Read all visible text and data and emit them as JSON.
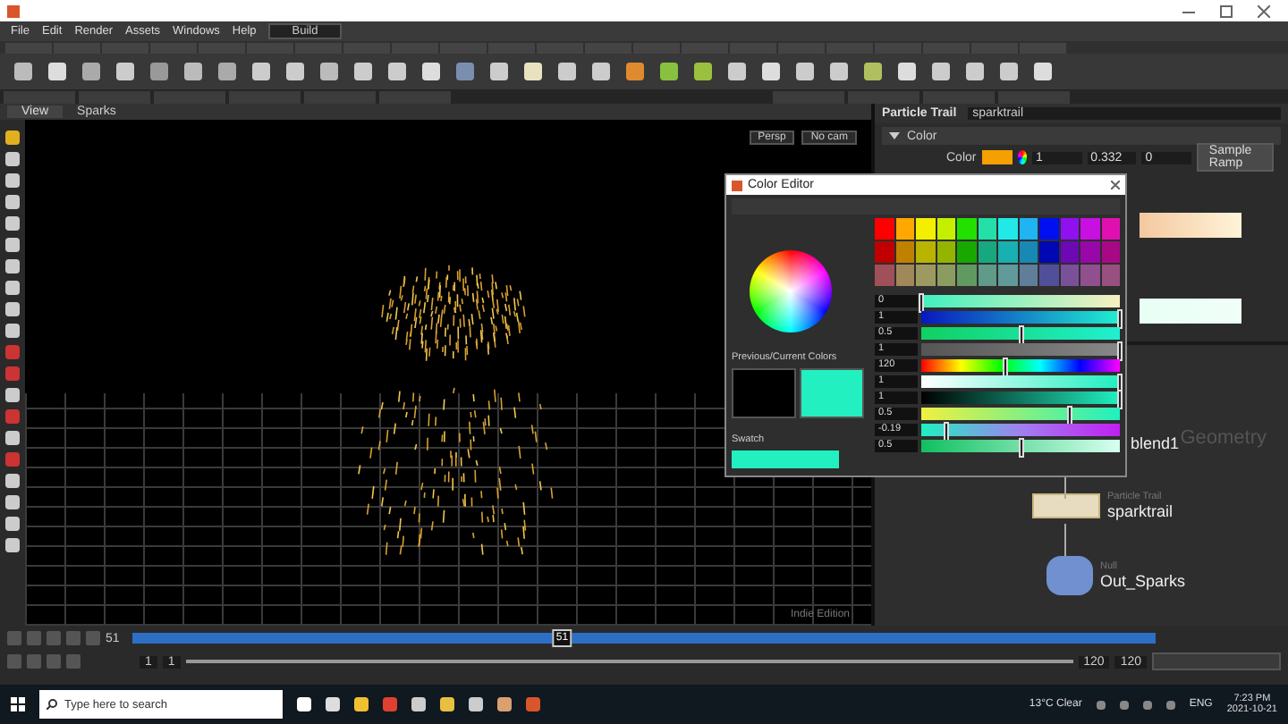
{
  "menu": [
    {
      "label": "File"
    },
    {
      "label": "Edit"
    },
    {
      "label": "Render"
    },
    {
      "label": "Assets"
    },
    {
      "label": "Windows"
    },
    {
      "label": "Help"
    }
  ],
  "desktop": "Build",
  "viewport": {
    "tab": "View",
    "path": "Sparks",
    "camera": "Persp",
    "camera_menu": "No cam",
    "edition_label": "Indie Edition"
  },
  "color_editor": {
    "title": "Color Editor",
    "previous_current_label": "Previous/Current Colors",
    "swatch_label": "Swatch",
    "previous_current": [
      {
        "color": "#000000"
      },
      {
        "color": "#22f0c0"
      }
    ],
    "swatches": [
      {
        "color": "#ff0000"
      },
      {
        "color": "#ffa800"
      },
      {
        "color": "#f4ee00"
      },
      {
        "color": "#c4f000"
      },
      {
        "color": "#22e000"
      },
      {
        "color": "#22e0a8"
      },
      {
        "color": "#22e8e8"
      },
      {
        "color": "#20b4f0"
      },
      {
        "color": "#0010f0"
      },
      {
        "color": "#9010f0"
      },
      {
        "color": "#c810e0"
      },
      {
        "color": "#e010b0"
      },
      {
        "color": "#c00000"
      },
      {
        "color": "#c08000"
      },
      {
        "color": "#b8b400"
      },
      {
        "color": "#94b400"
      },
      {
        "color": "#18a800"
      },
      {
        "color": "#18a880"
      },
      {
        "color": "#18b0b0"
      },
      {
        "color": "#1888b4"
      },
      {
        "color": "#0008b4"
      },
      {
        "color": "#6c08b4"
      },
      {
        "color": "#9808a8"
      },
      {
        "color": "#a80884"
      },
      {
        "color": "#a05058"
      },
      {
        "color": "#a08858"
      },
      {
        "color": "#9c9a60"
      },
      {
        "color": "#8a9c60"
      },
      {
        "color": "#609a60"
      },
      {
        "color": "#609a88"
      },
      {
        "color": "#609a9a"
      },
      {
        "color": "#607e9a"
      },
      {
        "color": "#50509a"
      },
      {
        "color": "#7a509a"
      },
      {
        "color": "#90508e"
      },
      {
        "color": "#985080"
      }
    ],
    "sliders": [
      {
        "value": "0",
        "level": 0
      },
      {
        "value": "1",
        "level": 1
      },
      {
        "value": "0.5",
        "level": 0.5
      },
      {
        "value": "1",
        "level": 1
      },
      {
        "value": "120",
        "level": 0.42
      },
      {
        "value": "1",
        "level": 1
      },
      {
        "value": "1",
        "level": 1
      },
      {
        "value": "0.5",
        "level": 0.75
      },
      {
        "value": "-0.19",
        "level": 0.13
      },
      {
        "value": "0.5",
        "level": 0.5
      }
    ]
  },
  "parameters": {
    "node_type": "Particle Trail",
    "node_name": "sparktrail",
    "folder": {
      "label": "Color",
      "expanded": true
    },
    "color_label": "Color",
    "color": "#f5a000",
    "values": [
      "1",
      "0.332",
      "0"
    ],
    "ramp_button": "Sample Ramp"
  },
  "network": {
    "context": "Geometry",
    "nodes": [
      {
        "kind": "blend",
        "name": "blend1"
      },
      {
        "kind": "trail",
        "type_label": "Particle Trail",
        "name": "sparktrail"
      },
      {
        "kind": "null",
        "type_label": "Null",
        "name": "Out_Sparks"
      }
    ]
  },
  "timeline": {
    "frame": "51",
    "playhead_label": "51",
    "level": 0.42,
    "range": {
      "level": 1
    },
    "start": "1",
    "range_start": "1",
    "range_end": "120",
    "end": "120"
  },
  "taskbar": {
    "search_placeholder": "Type here to search",
    "weather": "13°C Clear",
    "language": "ENG",
    "time": "7:23 PM",
    "date": "2021-10-21"
  }
}
